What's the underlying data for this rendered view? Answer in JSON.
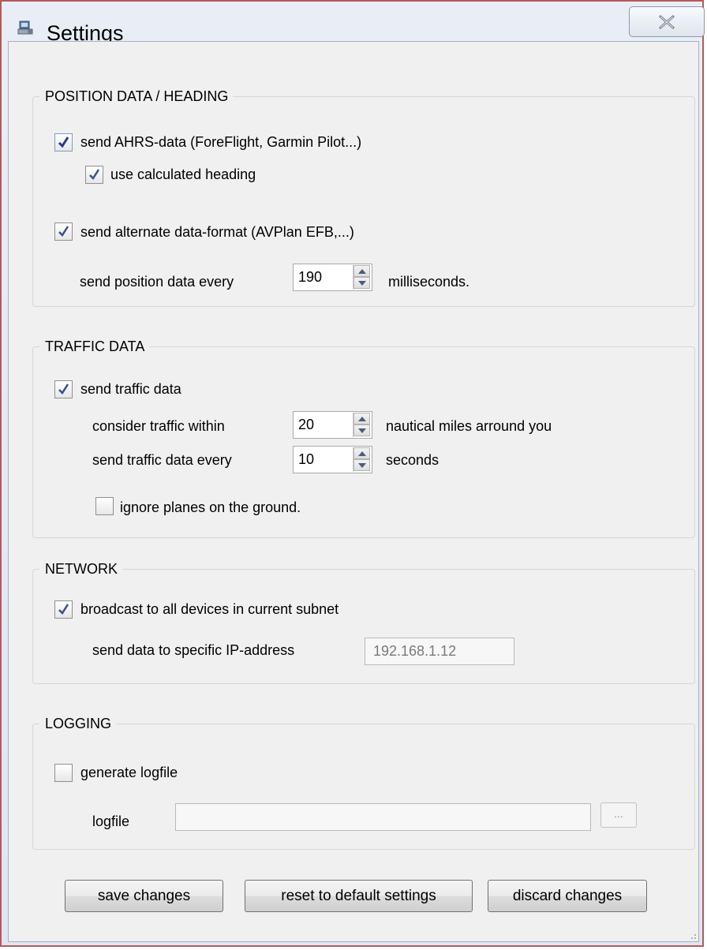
{
  "window": {
    "title": "Settings",
    "close_icon": "close-x-icon",
    "app_icon": "app-settings-icon"
  },
  "position_group": {
    "title": "POSITION DATA / HEADING",
    "send_ahrs": {
      "label": "send AHRS-data (ForeFlight, Garmin Pilot...)",
      "checked": true
    },
    "use_calculated_heading": {
      "label": "use calculated heading",
      "checked": true
    },
    "send_alternate": {
      "label": "send alternate data-format (AVPlan EFB,...)",
      "checked": true
    },
    "interval_prefix": "send position data every",
    "interval_value": "190",
    "interval_suffix": "milliseconds."
  },
  "traffic_group": {
    "title": "TRAFFIC DATA",
    "send_traffic": {
      "label": "send traffic data",
      "checked": true
    },
    "range_prefix": "consider traffic within",
    "range_value": "20",
    "range_suffix": "nautical miles arround you",
    "interval_prefix": "send traffic data every",
    "interval_value": "10",
    "interval_suffix": "seconds",
    "ignore_ground": {
      "label": "ignore planes on the ground.",
      "checked": false
    }
  },
  "network_group": {
    "title": "NETWORK",
    "broadcast": {
      "label": "broadcast to all devices in current subnet",
      "checked": true
    },
    "ip_label": "send data to specific IP-address",
    "ip_value": "192.168.1.12"
  },
  "logging_group": {
    "title": "LOGGING",
    "generate_logfile": {
      "label": "generate logfile",
      "checked": false
    },
    "logfile_label": "logfile",
    "logfile_value": "",
    "browse_label": "..."
  },
  "buttons": {
    "save": "save changes",
    "reset": "reset to default settings",
    "discard": "discard changes"
  },
  "colors": {
    "window_border": "#b45a5a",
    "client_bg": "#f0f0f0",
    "check_mark": "#2a3f8f"
  }
}
